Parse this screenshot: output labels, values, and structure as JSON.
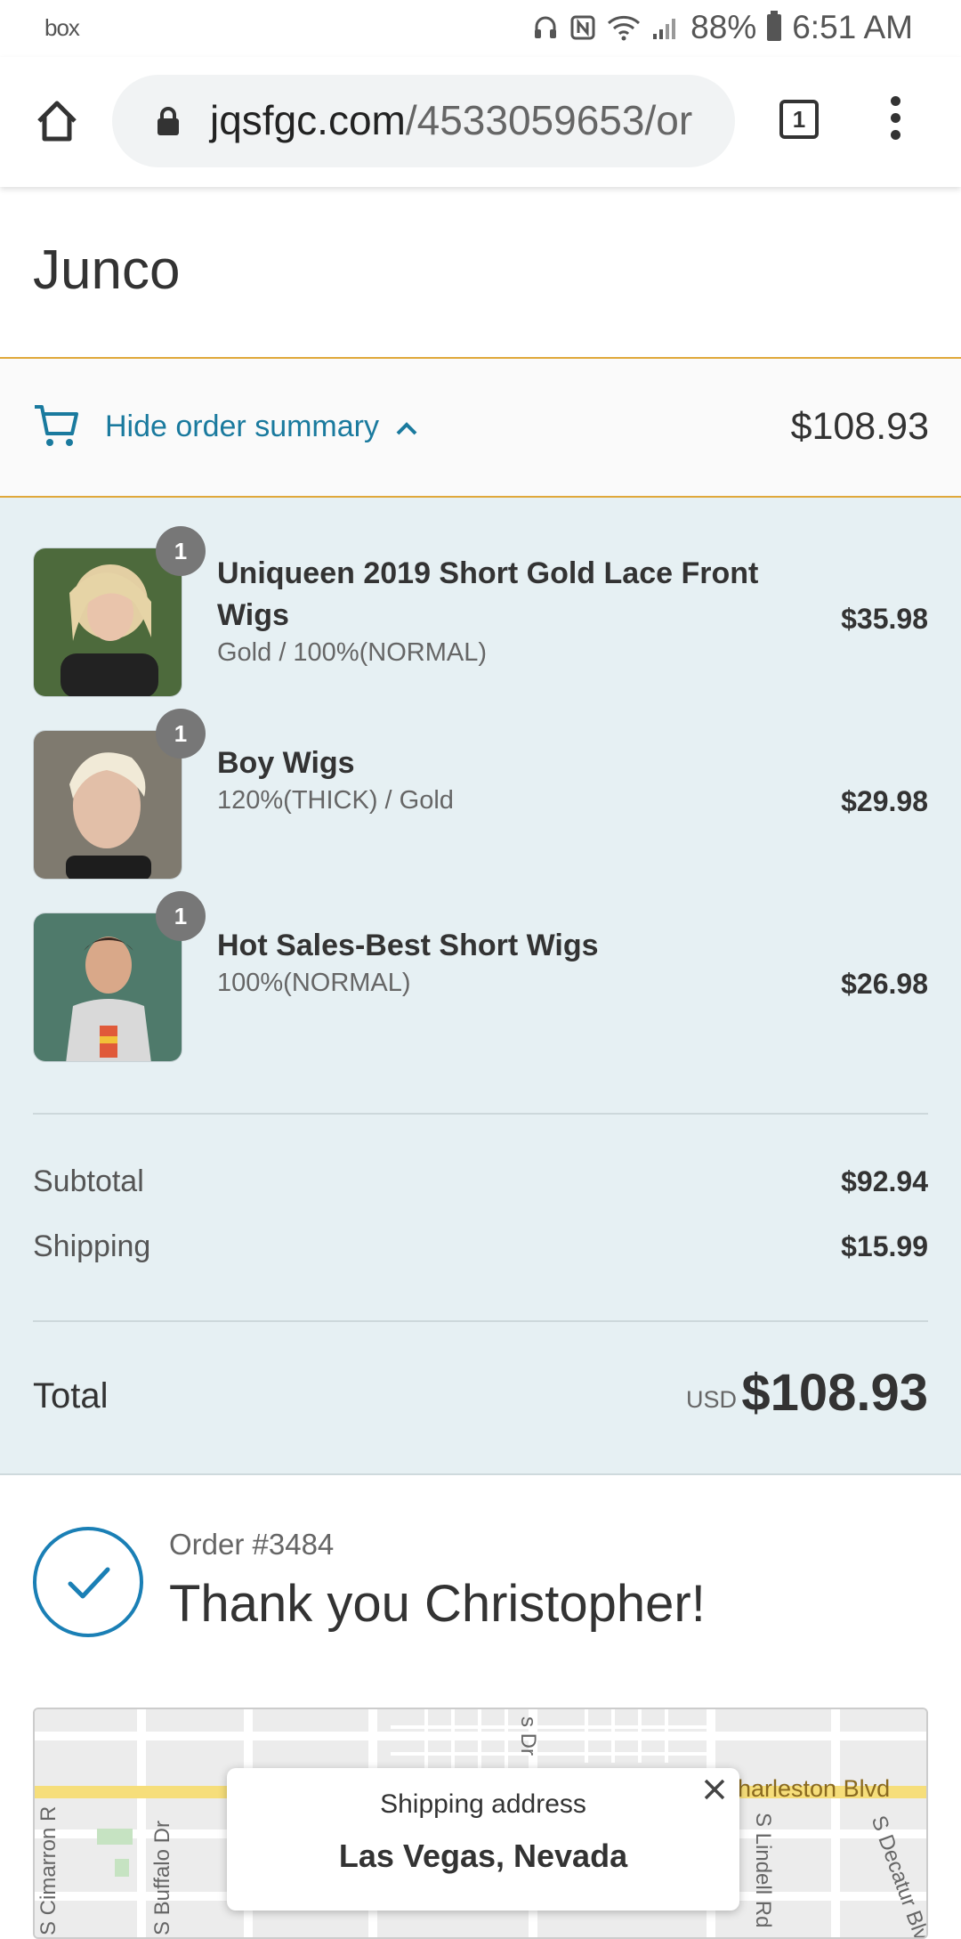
{
  "status_bar": {
    "carrier": "box",
    "battery": "88%",
    "time": "6:51 AM"
  },
  "browser": {
    "url_domain": "jqsfgc.com",
    "url_path": "/4533059653/or",
    "tab_count": "1"
  },
  "store": {
    "name": "Junco"
  },
  "summary_toggle": {
    "label": "Hide order summary",
    "total": "$108.93"
  },
  "products": [
    {
      "quantity": "1",
      "title": "Uniqueen 2019 Short Gold Lace Front Wigs",
      "variant": "Gold / 100%(NORMAL)",
      "price": "$35.98"
    },
    {
      "quantity": "1",
      "title": "Boy Wigs",
      "variant": "120%(THICK) / Gold",
      "price": "$29.98"
    },
    {
      "quantity": "1",
      "title": "Hot Sales-Best Short Wigs",
      "variant": "100%(NORMAL)",
      "price": "$26.98"
    }
  ],
  "totals": {
    "subtotal_label": "Subtotal",
    "subtotal": "$92.94",
    "shipping_label": "Shipping",
    "shipping": "$15.99",
    "total_label": "Total",
    "currency": "USD",
    "total": "$108.93"
  },
  "confirmation": {
    "order_number": "Order #3484",
    "thank_you": "Thank you Christopher!"
  },
  "map": {
    "streets": [
      "s Dr",
      "harleston Blvd",
      "S Cimarron R",
      "S Buffalo Dr",
      "S Lindell Rd",
      "S Decatur Blvd"
    ],
    "popup_title": "Shipping address",
    "popup_city": "Las Vegas, Nevada"
  },
  "colors": {
    "accent": "#1a7a9e",
    "summary_bg": "#e6f0f3",
    "toggle_border": "#e0a83a",
    "check": "#1a7fb5"
  }
}
